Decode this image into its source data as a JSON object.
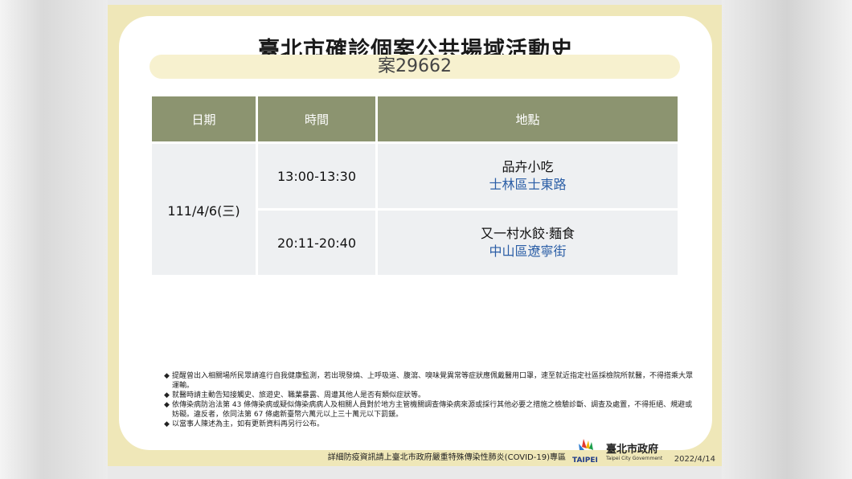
{
  "poster": {
    "title": "臺北市確診個案公共場域活動史",
    "case_no": "案29662",
    "table": {
      "headers": [
        "日期",
        "時間",
        "地點"
      ],
      "date": "111/4/6(三)",
      "rows": [
        {
          "time": "13:00-13:30",
          "place": "品卉小吃",
          "district": "士林區士東路"
        },
        {
          "time": "20:11-20:40",
          "place": "又一村水餃‧麵食",
          "district": "中山區遼寧街"
        }
      ]
    },
    "notes": [
      "提醒曾出入相關場所民眾請進行自我健康監測，若出現發燒、上呼吸道、腹瀉、嗅味覺異常等症狀應佩戴醫用口罩，速至就近指定社區採檢院所就醫，不得搭乘大眾運輸。",
      "就醫時請主動告知接觸史、旅遊史、職業暴露、周遭其他人是否有類似症狀等。",
      "依傳染病防治法第 43 條傳染病或疑似傳染病病人及相關人員對於地方主管機關調查傳染病來源或採行其他必要之措施之檢驗診斷、調查及處置，不得拒絕、規避或妨礙。違反者，依同法第 67 條處新臺幣六萬元以上三十萬元以下罰鍰。",
      "以當事人陳述為主，如有更新資料再另行公布。"
    ],
    "bullet": "◆",
    "footer": "詳細防疫資訊請上臺北市政府嚴重特殊傳染性肺炎(COVID-19)專區",
    "logo": {
      "word": "TAIPEI",
      "cn": "臺北市政府",
      "en": "Taipei City Government"
    },
    "date": "2022/4/14"
  }
}
